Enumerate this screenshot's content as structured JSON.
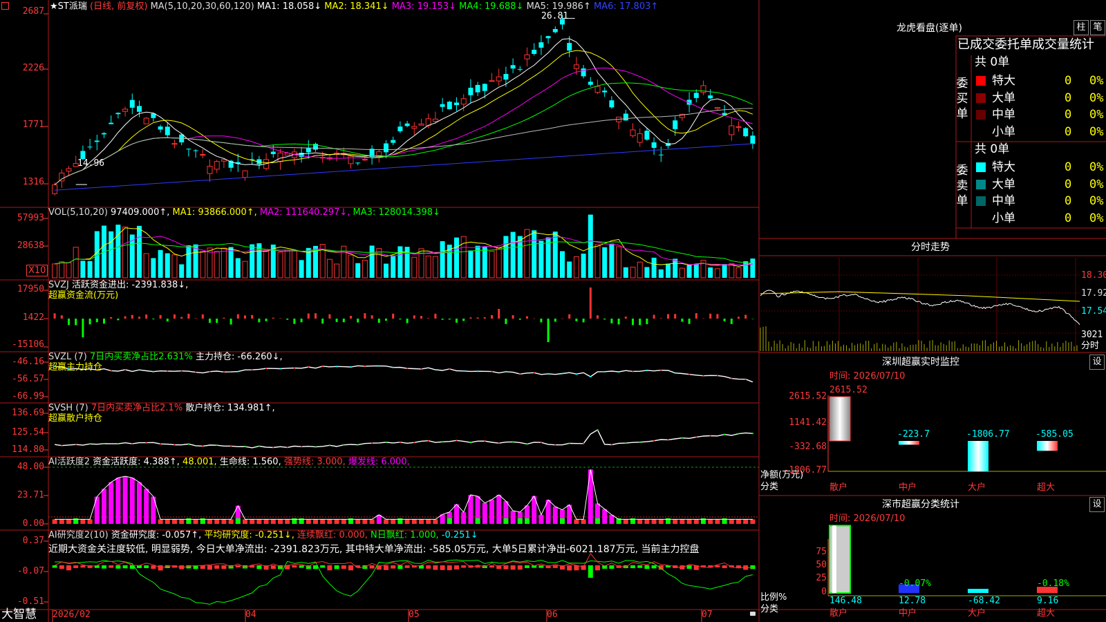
{
  "colors": {
    "up": "#ff3232",
    "down": "#00ffff",
    "border": "#b01818",
    "axis": "#ff3a3a",
    "ma1": "#ffffff",
    "ma2": "#ffff00",
    "ma3": "#ff00ff",
    "ma4": "#00ff00",
    "ma5": "#bbbbbb",
    "ma6": "#2f3cff",
    "magenta": "#ff00ff",
    "green": "#00ff00"
  },
  "main": {
    "stock": "★ST派瑞",
    "mode": "(日线, 前复权)",
    "ma_params": "MA(5,10,20,30,60,120)",
    "ma1": "MA1: 18.058↓",
    "ma2": "MA2: 18.341↓",
    "ma3": "MA3: 19.153↓",
    "ma4": "MA4: 19.688↓",
    "ma5": "MA5: 19.986↑",
    "ma6": "MA6: 17.803↑",
    "y_ticks": [
      "2687",
      "2226",
      "1771",
      "1316"
    ],
    "high_label": "26.81",
    "low_label": "14.96"
  },
  "vol": {
    "title": "VOL(5,10,20)",
    "value": "97409.000↑",
    "ma1": "MA1: 93866.000↑",
    "ma2": "MA2: 111640.297↓",
    "ma3": "MA3: 128014.398↓",
    "y_ticks": [
      "57993",
      "28638"
    ],
    "unit": "X10"
  },
  "svzj": {
    "title": "SVZJ",
    "label": "活跃资金进出: -2391.838↓,",
    "sub": "超赢资金流(万元)",
    "y_ticks": [
      "17950",
      "1422",
      "-15106"
    ]
  },
  "svzl": {
    "title": "SVZL (7)",
    "ratio": "7日内买卖净占比2.631%",
    "hold": "主力持仓: -66.260↓,",
    "sub": "超赢主力持仓",
    "y_ticks": [
      "-46.16",
      "-56.57",
      "-66.99"
    ]
  },
  "svsh": {
    "title": "SVSH (7)",
    "ratio": "7日内买卖净占比2.1%",
    "hold": "散户持仓: 134.981↑,",
    "sub": "超赢散户持仓",
    "y_ticks": [
      "136.69",
      "125.54",
      "114.80"
    ]
  },
  "ai1": {
    "title": "AI活跃度2",
    "a": "资金活跃度: 4.388↑",
    "b": "48.001",
    "c": "生命线: 1.560",
    "d": "强势线: 3.000",
    "e": "爆发线: 6.000",
    "y_ticks": [
      "48.00",
      "23.71",
      "0.00"
    ]
  },
  "ai2": {
    "title": "AI研究度2(10)",
    "a": "资金研究度: -0.057↑",
    "b": "平均研究度: -0.251↓",
    "c": "连续飘红: 0.000",
    "d": "N日飘红: 1.000",
    "e": "-0.251↓",
    "desc": "近期大资金关注度较低, 明显弱势, 今日大单净流出: -2391.823万元, 其中特大单净流出: -585.05万元, 大单5日累计净出-6021.187万元, 当前主力控盘",
    "y_ticks": [
      "0.37",
      "-0.07",
      "-0.51"
    ]
  },
  "xaxis": {
    "brand": "大智慧",
    "labels": [
      "2026/02",
      "04",
      "05",
      "06",
      "07"
    ]
  },
  "longhu": {
    "title": "龙虎看盘(逐单)",
    "btn1": "柱",
    "btn2": "笔",
    "tab": "已成交委托单成交量统计",
    "buy": {
      "side": "委买单",
      "total": "共 0单",
      "rows": [
        {
          "name": "特大",
          "count": "0",
          "pct": "0%"
        },
        {
          "name": "大单",
          "count": "0",
          "pct": "0%"
        },
        {
          "name": "中单",
          "count": "0",
          "pct": "0%"
        },
        {
          "name": "小单",
          "count": "0",
          "pct": "0%"
        }
      ]
    },
    "sell": {
      "side": "委卖单",
      "total": "共 0单",
      "rows": [
        {
          "name": "特大",
          "count": "0",
          "pct": "0%"
        },
        {
          "name": "大单",
          "count": "0",
          "pct": "0%"
        },
        {
          "name": "中单",
          "count": "0",
          "pct": "0%"
        },
        {
          "name": "小单",
          "count": "0",
          "pct": "0%"
        }
      ]
    }
  },
  "fenshi": {
    "title": "分时走势",
    "p1": "18.30",
    "p2": "17.92",
    "p3": "17.54",
    "vol": "3021",
    "unit": "分时"
  },
  "monitor": {
    "title": "深圳超赢实时监控",
    "btn": "设",
    "time": "时间: 2026/07/10",
    "y_ticks": [
      "2615.52",
      "1141.42",
      "-332.68",
      "-1806.77"
    ],
    "top_label": "2615.52",
    "ylabel1": "净额(万元)",
    "ylabel2": "分类",
    "bars": [
      {
        "cat": "散户",
        "value": 2615.52,
        "label": ""
      },
      {
        "cat": "中户",
        "value": -223.7,
        "label": "-223.7"
      },
      {
        "cat": "大户",
        "value": -1806.77,
        "label": "-1806.77"
      },
      {
        "cat": "超大",
        "value": -585.05,
        "label": "-585.05"
      }
    ]
  },
  "stats": {
    "title": "深市超赢分类统计",
    "btn": "设",
    "time": "时间: 2026/07/10",
    "y_ticks": [
      "75",
      "50",
      "25",
      "0"
    ],
    "ylabel1": "比例%",
    "ylabel2": "分类",
    "bars": [
      {
        "cat": "散户",
        "value": 146.48,
        "label": "146.48",
        "top": ""
      },
      {
        "cat": "中户",
        "value": 12.78,
        "label": "12.78",
        "top": "-0.07%"
      },
      {
        "cat": "大户",
        "value": -68.42,
        "label": "-68.42",
        "top": ""
      },
      {
        "cat": "超大",
        "value": 9.16,
        "label": "9.16",
        "top": "-0.18%"
      }
    ]
  }
}
